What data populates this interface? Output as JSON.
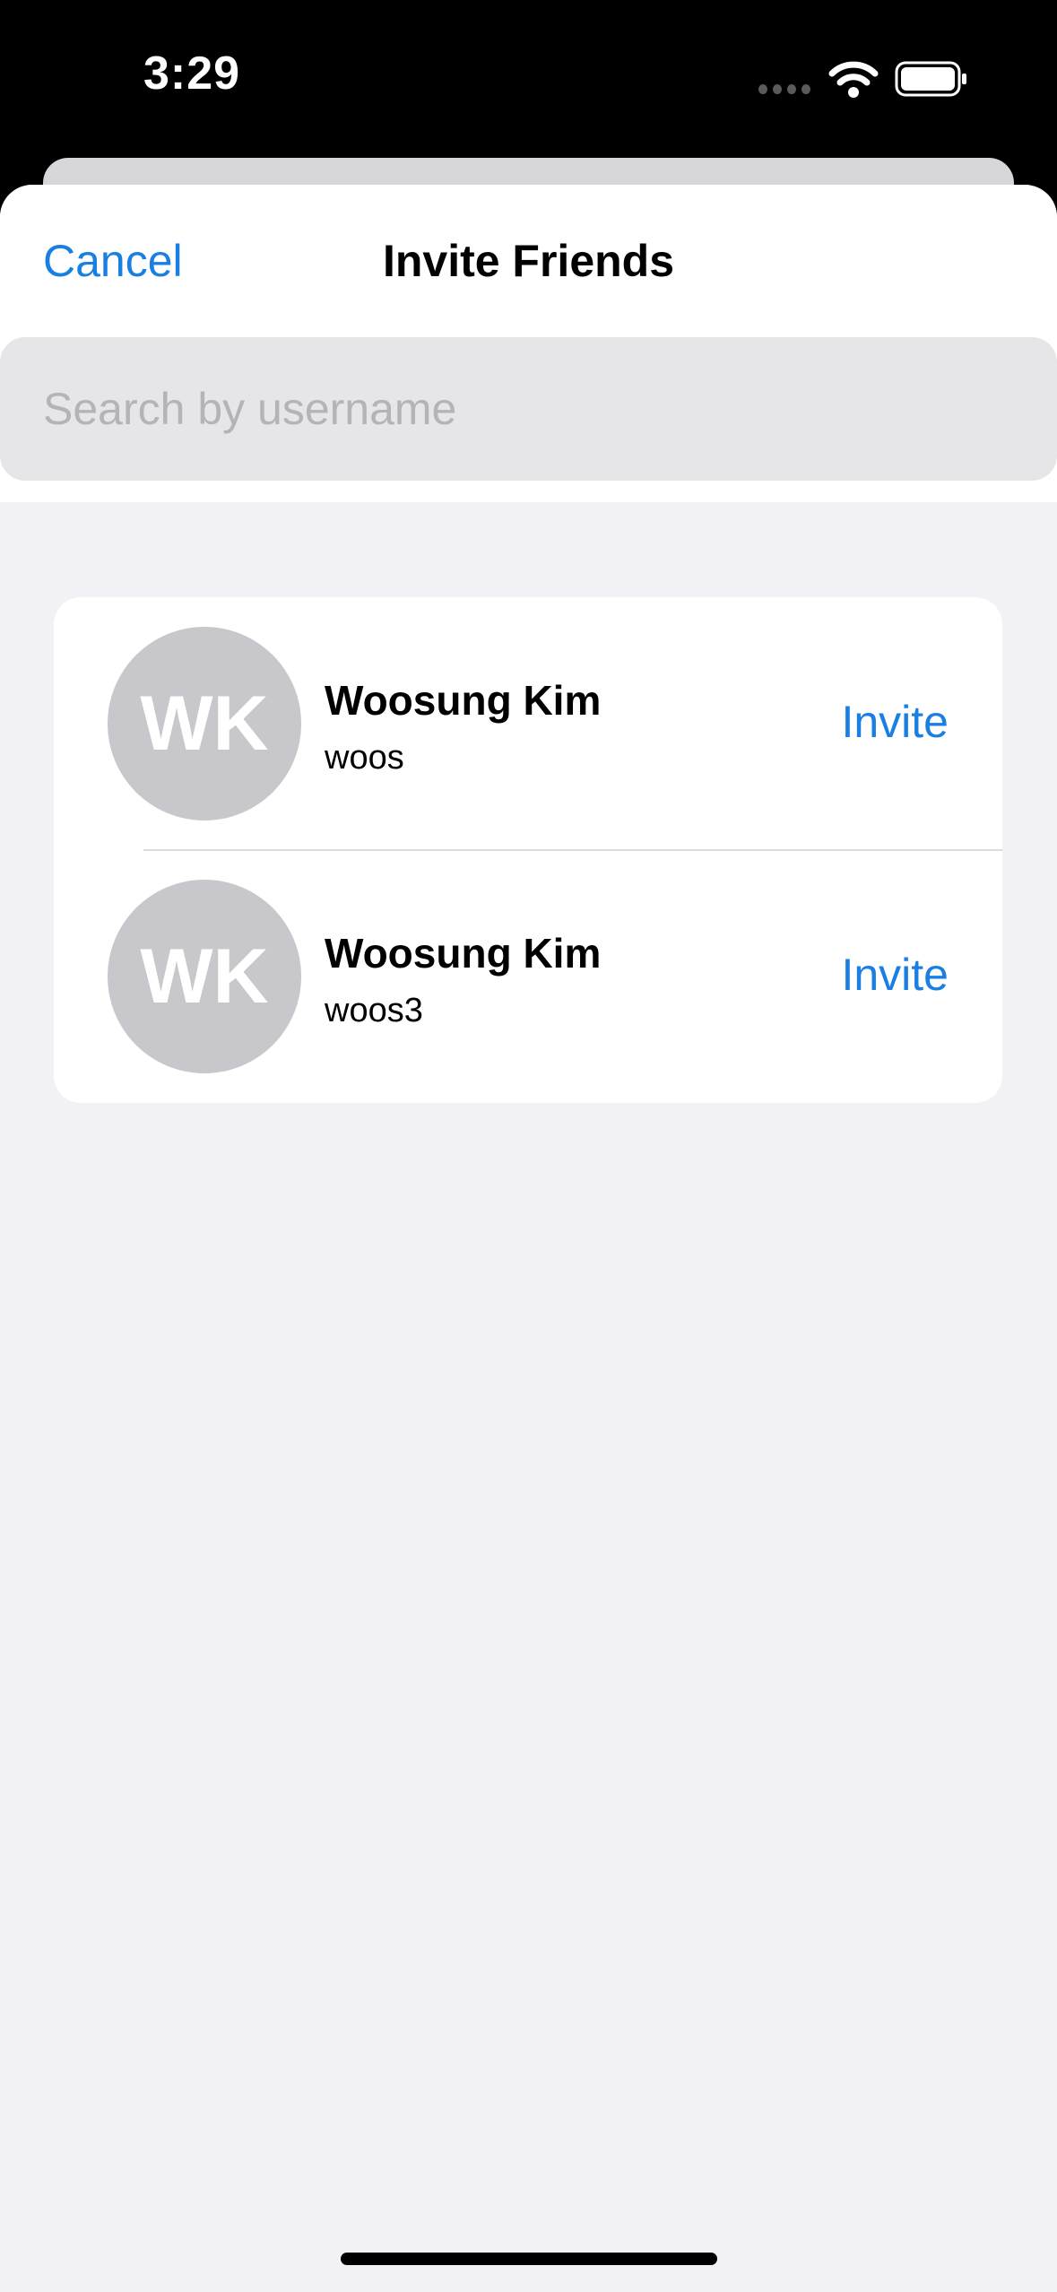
{
  "status_bar": {
    "time": "3:29",
    "icons": [
      "signal-dots-icon",
      "wifi-icon",
      "battery-icon"
    ]
  },
  "header": {
    "cancel_label": "Cancel",
    "title": "Invite Friends"
  },
  "search": {
    "placeholder": "Search by username",
    "value": ""
  },
  "friends": [
    {
      "initials": "WK",
      "name": "Woosung Kim",
      "username": "woos",
      "action_label": "Invite"
    },
    {
      "initials": "WK",
      "name": "Woosung Kim",
      "username": "woos3",
      "action_label": "Invite"
    }
  ],
  "colors": {
    "accent": "#1a7fe3",
    "avatar_bg": "#c8c8cc",
    "background": "#f1f1f6",
    "search_bg": "#e6e6e8"
  }
}
